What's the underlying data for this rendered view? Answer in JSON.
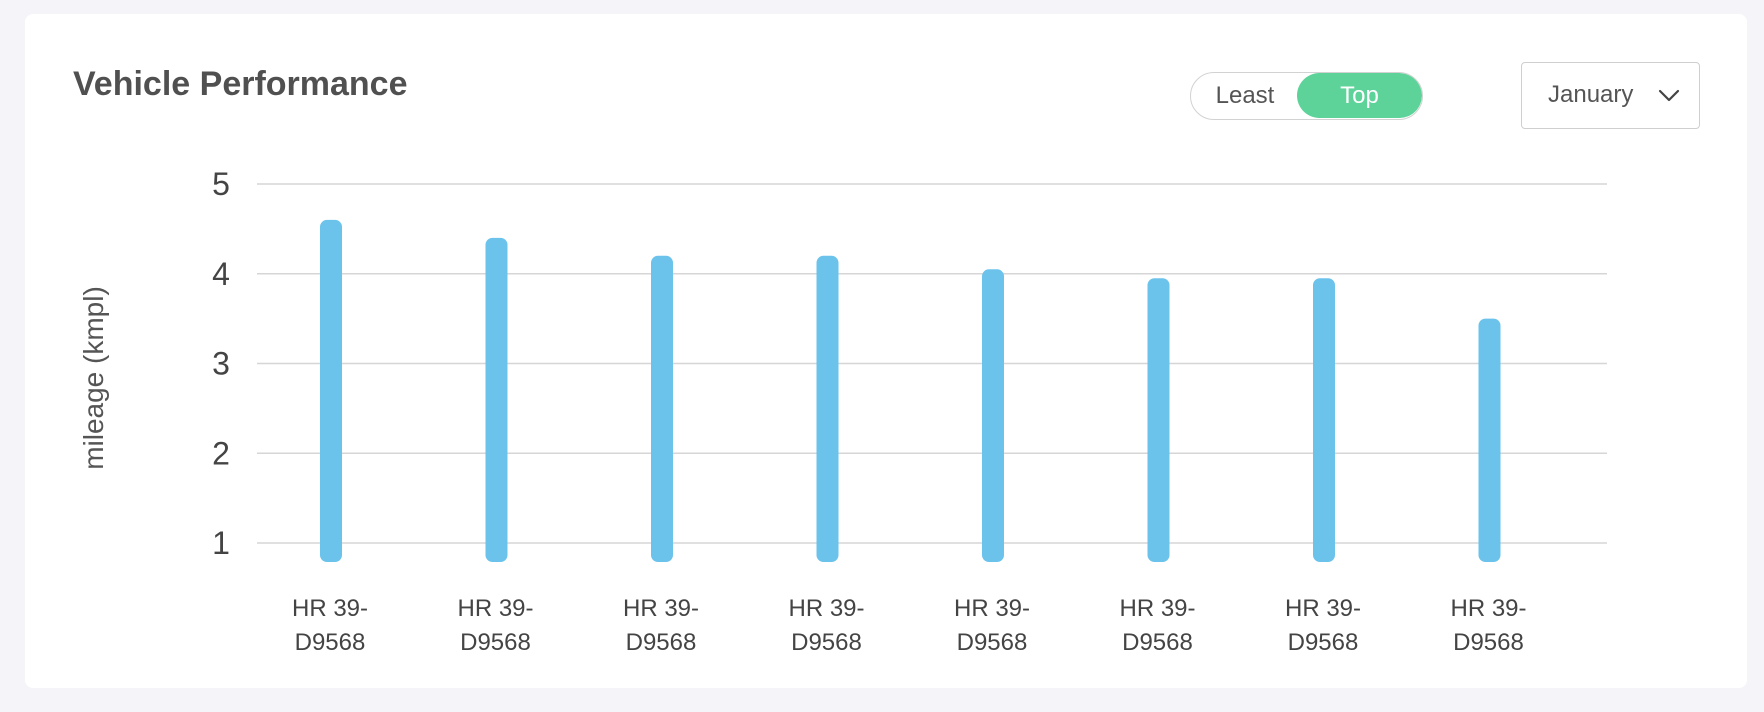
{
  "header": {
    "title": "Vehicle Performance"
  },
  "toggle": {
    "options": [
      "Least",
      "Top"
    ],
    "selected": "Top"
  },
  "month_select": {
    "value": "January",
    "icon": "chevron-down-icon"
  },
  "colors": {
    "bar": "#6bc3ec",
    "toggle_active": "#5dd39a",
    "grid": "#d6d6d6"
  },
  "chart_data": {
    "type": "bar",
    "categories": [
      [
        "HR 39-",
        "D9568"
      ],
      [
        "HR 39-",
        "D9568"
      ],
      [
        "HR 39-",
        "D9568"
      ],
      [
        "HR 39-",
        "D9568"
      ],
      [
        "HR 39-",
        "D9568"
      ],
      [
        "HR 39-",
        "D9568"
      ],
      [
        "HR 39-",
        "D9568"
      ],
      [
        "HR 39-",
        "D9568"
      ]
    ],
    "values": [
      4.6,
      4.4,
      4.2,
      4.2,
      4.05,
      3.95,
      3.95,
      3.5
    ],
    "title": "Vehicle Performance",
    "xlabel": "",
    "ylabel": "mileage (kmpl)",
    "yticks": [
      1,
      2,
      3,
      4,
      5
    ],
    "ylim": [
      1,
      5
    ],
    "grid": true,
    "legend": "none"
  }
}
